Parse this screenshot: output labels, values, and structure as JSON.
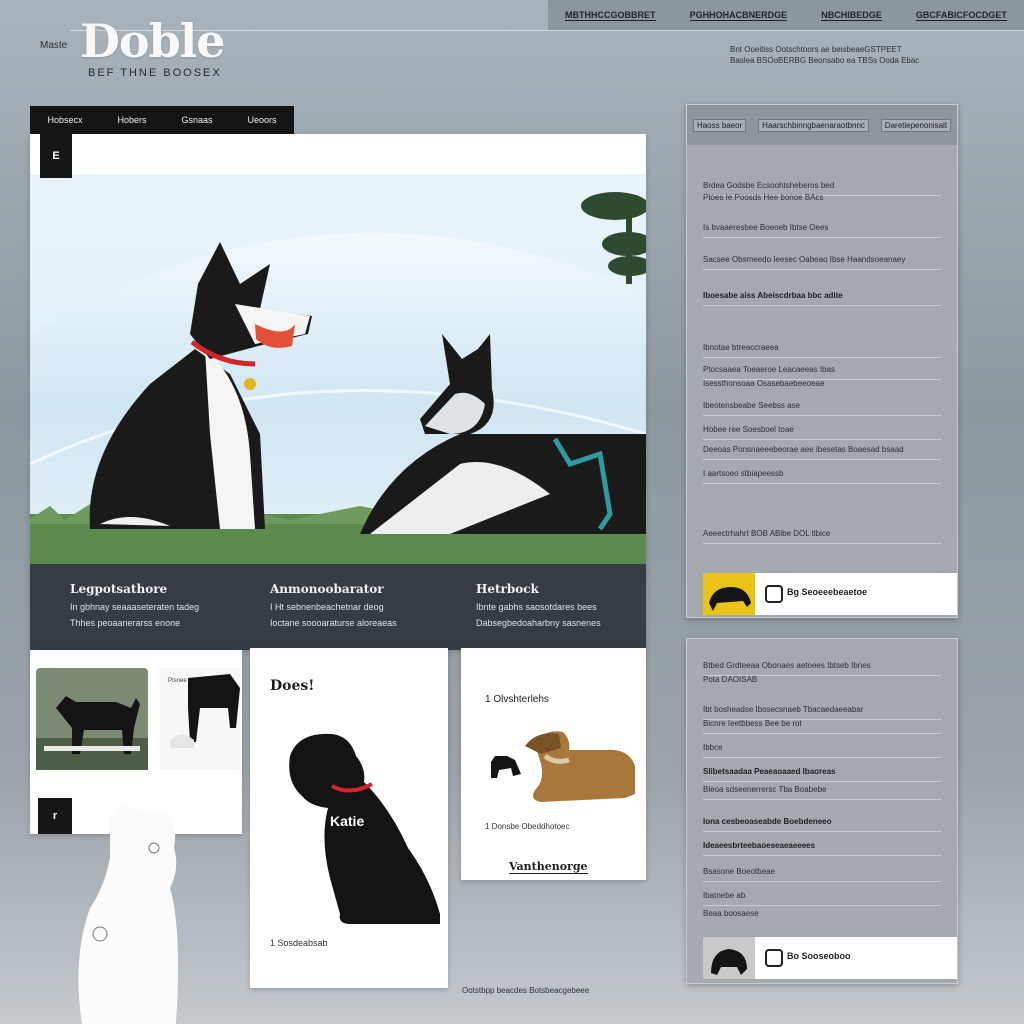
{
  "header": {
    "logo_small": "Maste",
    "logo": "Doble",
    "tagline": "BEF THNE BOOSEX",
    "nav": [
      "MBTHHCCGOBBRET",
      "PGHHOHACBNERDGE",
      "NBCHIBEDGE",
      "GBCFABICFOCDGET"
    ],
    "note_lines": [
      "Bnt Ooeitiss Ootschtoors ae beisbeaeGSTPEET",
      "Baslea BSOoBERBG Beonsabo ea TBSs Ooda Ebac"
    ]
  },
  "left_nav": [
    "Hobsecx",
    "Hobers",
    "Gsnaas",
    "Ueoors"
  ],
  "hero": {
    "badge": "E",
    "colors": {
      "sky": "#cfe6f3",
      "grass": "#5d8a4f",
      "collar": "#d3262a",
      "harness": "#2f9aa0"
    }
  },
  "info": [
    {
      "title": "Legpotsathore",
      "lines": [
        "In gbhnay seaaaseteraten tadeg",
        "Thhes peoaanerarss enone"
      ]
    },
    {
      "title": "Anmonoobarator",
      "lines": [
        "I Ht sebnenbeachetnar deog",
        "Ioctane soooaraturse aloreaeas"
      ]
    },
    {
      "title": "Hetrbock",
      "lines": [
        "Ibnte gabhs saosotdares bees",
        "Dabsegbedoaharbny sasnenes"
      ]
    }
  ],
  "cards": {
    "a": {
      "badge": "r",
      "caption": "Ptsnee"
    },
    "b": {
      "title": "Does!",
      "dog_label": "Katie",
      "footer": "1  Sosdeabsab"
    },
    "c": {
      "title": "1  Olvshterlehs",
      "meta": "1  Donsbe Obeddhotoec",
      "link": "Vanthenorge"
    }
  },
  "bottom_caption": "Ootstbpp beacdes Botsbeacgebeee",
  "panel_top": {
    "nav": [
      "Haoss baeor",
      "Haarschbinngbaenaraotbnnc",
      "Daretiepenonisalt"
    ],
    "rows": [
      {
        "text": "Brdea Godsbe Ecsoohtsheberos bed",
        "bold": false
      },
      {
        "text": "Ptoes Ie Poosds Hee bonoe BAcs",
        "bold": false
      },
      {
        "text": "Is  bvaaeresbee Boeoeb Ibtse Oees",
        "bold": false
      },
      {
        "text": "Sacsee Obsmeedo Ieesec Oabeao Ibse Haandsoeanaey",
        "bold": false
      },
      {
        "text": "Iboesabe aiss Abeiscdrbaa bbc adite",
        "bold": true
      },
      {
        "text": "Ibnotae btreaccraeea",
        "bold": false
      },
      {
        "text": "Ptocsaaea Toeaeroe  Leacaeeas Ibas",
        "bold": false
      },
      {
        "text": "Isessthonsoaa Osasebaebeeoeae",
        "bold": false
      },
      {
        "text": "Ibeotensbeabe Seebss ase",
        "bold": false
      },
      {
        "text": "Hobee ree Soesboel toae",
        "bold": false
      },
      {
        "text": "Deeoas Ponsnaeeebeorae aee ibesetas Boaesad bsaad",
        "bold": false
      },
      {
        "text": "I aartsoeo stbiapeessb",
        "bold": false
      },
      {
        "text": "Aeeectrhahrt BOB  ABibe DOL tlbice",
        "bold": false
      }
    ],
    "profile": {
      "name": "Bg  Seoeeebeaetoe",
      "thumb_bg": "#e9c315"
    }
  },
  "panel_bottom": {
    "rows": [
      {
        "text": "Btbed Grdteeaa Obonaes aetoees Ibtseb Ibnes",
        "bold": false
      },
      {
        "text": "Pota DAOISAB",
        "bold": false
      },
      {
        "text": "Ibt bosheadse Ibosecsnaeb Tbacaedaeeabar",
        "bold": false
      },
      {
        "text": "Bicnre Ieetbbess   Bee be rot",
        "bold": false
      },
      {
        "text": "Ibbce",
        "bold": false
      },
      {
        "text": "Slibetsaadaa Peaeaoaaed Ibaoreas",
        "bold": true
      },
      {
        "text": "Bleoa sdseenerrersc Tba Boabebe",
        "bold": false
      },
      {
        "text": "Iona cesbeoaseabde Boebdeneeo",
        "bold": true
      },
      {
        "text": "Ideaeesbrteebaoeseaeaeeees",
        "bold": true
      },
      {
        "text": "Bsasone Boeotbeae",
        "bold": false
      },
      {
        "text": "Ibatnebe ab",
        "bold": false
      },
      {
        "text": "Beaa boosaese",
        "bold": false
      }
    ],
    "profile": {
      "name": "Bo  Sooseoboo",
      "thumb_bg": "#c9c9c9"
    }
  }
}
